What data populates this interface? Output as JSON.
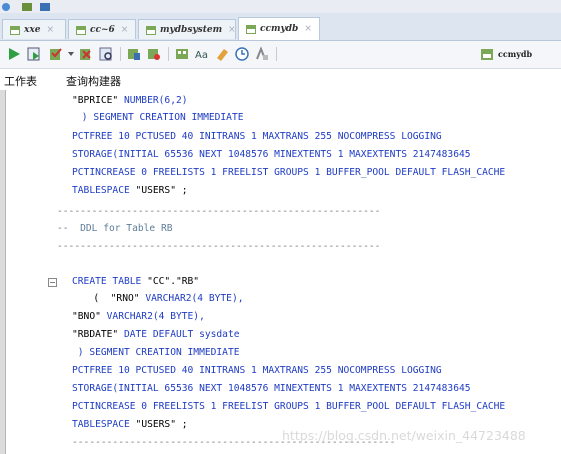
{
  "tabs": [
    {
      "label": "xxe",
      "active": false
    },
    {
      "label": "cc~6",
      "active": false
    },
    {
      "label": "mydbsystem",
      "active": false
    },
    {
      "label": "ccmydb",
      "active": true
    }
  ],
  "toolbar": {
    "connection_label": "ccmydb",
    "icons": [
      "run-statement-icon",
      "run-script-icon",
      "commit-icon",
      "rollback-icon",
      "autotrace-icon",
      "explain-plan-icon",
      "sql-tuning-icon",
      "clear-icon",
      "to-uppercase-icon",
      "eraser-icon",
      "history-icon",
      "format-icon"
    ]
  },
  "subtabs": {
    "worksheet": "工作表",
    "query_builder": "查询构建器"
  },
  "code": [
    {
      "text": "\"BPRICE\" NUMBER(6,2)",
      "type": "mixed",
      "kw_start": 9
    },
    {
      "text": " ) SEGMENT CREATION IMMEDIATE",
      "type": "kw"
    },
    {
      "text": "PCTFREE 10 PCTUSED 40 INITRANS 1 MAXTRANS 255 NOCOMPRESS LOGGING",
      "type": "kw"
    },
    {
      "text": "STORAGE(INITIAL 65536 NEXT 1048576 MINEXTENTS 1 MAXEXTENTS 2147483645",
      "type": "kw"
    },
    {
      "text": "PCTINCREASE 0 FREELISTS 1 FREELIST GROUPS 1 BUFFER_POOL DEFAULT FLASH_CACHE",
      "type": "kw"
    },
    {
      "text": "TABLESPACE \"USERS\" ;",
      "type": "mixed",
      "kw_start": 0,
      "kw_end": 10
    },
    {
      "text": "--------------------------------------------------------",
      "type": "dash"
    },
    {
      "text": "--  DDL for Table RB",
      "type": "cmt"
    },
    {
      "text": "--------------------------------------------------------",
      "type": "dash"
    },
    {
      "text": "",
      "type": "plain"
    },
    {
      "text": "CREATE TABLE \"CC\".\"RB\"",
      "type": "mixed",
      "kw_start": 0,
      "kw_end": 12
    },
    {
      "text": "   (  \"RNO\" VARCHAR2(4 BYTE),",
      "type": "mixed",
      "kw_start": 12
    },
    {
      "text": "\"BNO\" VARCHAR2(4 BYTE),",
      "type": "mixed",
      "kw_start": 6
    },
    {
      "text": "\"RBDATE\" DATE DEFAULT sysdate",
      "type": "mixed",
      "kw_start": 9
    },
    {
      "text": " ) SEGMENT CREATION IMMEDIATE",
      "type": "kw"
    },
    {
      "text": "PCTFREE 10 PCTUSED 40 INITRANS 1 MAXTRANS 255 NOCOMPRESS LOGGING",
      "type": "kw"
    },
    {
      "text": "STORAGE(INITIAL 65536 NEXT 1048576 MINEXTENTS 1 MAXEXTENTS 2147483645",
      "type": "kw"
    },
    {
      "text": "PCTINCREASE 0 FREELISTS 1 FREELIST GROUPS 1 BUFFER_POOL DEFAULT FLASH_CACHE",
      "type": "kw"
    },
    {
      "text": "TABLESPACE \"USERS\" ;",
      "type": "mixed",
      "kw_start": 0,
      "kw_end": 10
    },
    {
      "text": "--------------------------------------------------------",
      "type": "dash"
    }
  ],
  "watermark": "https://blog.csdn.net/weixin_44723488"
}
